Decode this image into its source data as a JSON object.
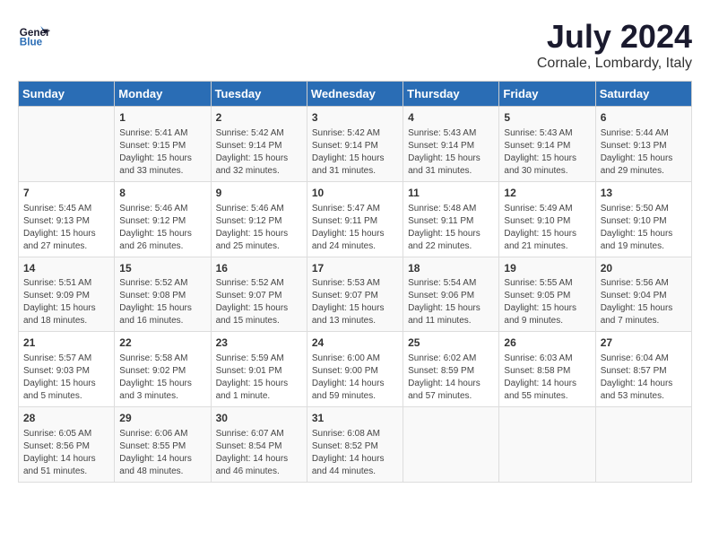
{
  "header": {
    "logo_general": "General",
    "logo_blue": "Blue",
    "month": "July 2024",
    "location": "Cornale, Lombardy, Italy"
  },
  "days_of_week": [
    "Sunday",
    "Monday",
    "Tuesday",
    "Wednesday",
    "Thursday",
    "Friday",
    "Saturday"
  ],
  "weeks": [
    [
      {
        "day": "",
        "info": ""
      },
      {
        "day": "1",
        "info": "Sunrise: 5:41 AM\nSunset: 9:15 PM\nDaylight: 15 hours\nand 33 minutes."
      },
      {
        "day": "2",
        "info": "Sunrise: 5:42 AM\nSunset: 9:14 PM\nDaylight: 15 hours\nand 32 minutes."
      },
      {
        "day": "3",
        "info": "Sunrise: 5:42 AM\nSunset: 9:14 PM\nDaylight: 15 hours\nand 31 minutes."
      },
      {
        "day": "4",
        "info": "Sunrise: 5:43 AM\nSunset: 9:14 PM\nDaylight: 15 hours\nand 31 minutes."
      },
      {
        "day": "5",
        "info": "Sunrise: 5:43 AM\nSunset: 9:14 PM\nDaylight: 15 hours\nand 30 minutes."
      },
      {
        "day": "6",
        "info": "Sunrise: 5:44 AM\nSunset: 9:13 PM\nDaylight: 15 hours\nand 29 minutes."
      }
    ],
    [
      {
        "day": "7",
        "info": "Sunrise: 5:45 AM\nSunset: 9:13 PM\nDaylight: 15 hours\nand 27 minutes."
      },
      {
        "day": "8",
        "info": "Sunrise: 5:46 AM\nSunset: 9:12 PM\nDaylight: 15 hours\nand 26 minutes."
      },
      {
        "day": "9",
        "info": "Sunrise: 5:46 AM\nSunset: 9:12 PM\nDaylight: 15 hours\nand 25 minutes."
      },
      {
        "day": "10",
        "info": "Sunrise: 5:47 AM\nSunset: 9:11 PM\nDaylight: 15 hours\nand 24 minutes."
      },
      {
        "day": "11",
        "info": "Sunrise: 5:48 AM\nSunset: 9:11 PM\nDaylight: 15 hours\nand 22 minutes."
      },
      {
        "day": "12",
        "info": "Sunrise: 5:49 AM\nSunset: 9:10 PM\nDaylight: 15 hours\nand 21 minutes."
      },
      {
        "day": "13",
        "info": "Sunrise: 5:50 AM\nSunset: 9:10 PM\nDaylight: 15 hours\nand 19 minutes."
      }
    ],
    [
      {
        "day": "14",
        "info": "Sunrise: 5:51 AM\nSunset: 9:09 PM\nDaylight: 15 hours\nand 18 minutes."
      },
      {
        "day": "15",
        "info": "Sunrise: 5:52 AM\nSunset: 9:08 PM\nDaylight: 15 hours\nand 16 minutes."
      },
      {
        "day": "16",
        "info": "Sunrise: 5:52 AM\nSunset: 9:07 PM\nDaylight: 15 hours\nand 15 minutes."
      },
      {
        "day": "17",
        "info": "Sunrise: 5:53 AM\nSunset: 9:07 PM\nDaylight: 15 hours\nand 13 minutes."
      },
      {
        "day": "18",
        "info": "Sunrise: 5:54 AM\nSunset: 9:06 PM\nDaylight: 15 hours\nand 11 minutes."
      },
      {
        "day": "19",
        "info": "Sunrise: 5:55 AM\nSunset: 9:05 PM\nDaylight: 15 hours\nand 9 minutes."
      },
      {
        "day": "20",
        "info": "Sunrise: 5:56 AM\nSunset: 9:04 PM\nDaylight: 15 hours\nand 7 minutes."
      }
    ],
    [
      {
        "day": "21",
        "info": "Sunrise: 5:57 AM\nSunset: 9:03 PM\nDaylight: 15 hours\nand 5 minutes."
      },
      {
        "day": "22",
        "info": "Sunrise: 5:58 AM\nSunset: 9:02 PM\nDaylight: 15 hours\nand 3 minutes."
      },
      {
        "day": "23",
        "info": "Sunrise: 5:59 AM\nSunset: 9:01 PM\nDaylight: 15 hours\nand 1 minute."
      },
      {
        "day": "24",
        "info": "Sunrise: 6:00 AM\nSunset: 9:00 PM\nDaylight: 14 hours\nand 59 minutes."
      },
      {
        "day": "25",
        "info": "Sunrise: 6:02 AM\nSunset: 8:59 PM\nDaylight: 14 hours\nand 57 minutes."
      },
      {
        "day": "26",
        "info": "Sunrise: 6:03 AM\nSunset: 8:58 PM\nDaylight: 14 hours\nand 55 minutes."
      },
      {
        "day": "27",
        "info": "Sunrise: 6:04 AM\nSunset: 8:57 PM\nDaylight: 14 hours\nand 53 minutes."
      }
    ],
    [
      {
        "day": "28",
        "info": "Sunrise: 6:05 AM\nSunset: 8:56 PM\nDaylight: 14 hours\nand 51 minutes."
      },
      {
        "day": "29",
        "info": "Sunrise: 6:06 AM\nSunset: 8:55 PM\nDaylight: 14 hours\nand 48 minutes."
      },
      {
        "day": "30",
        "info": "Sunrise: 6:07 AM\nSunset: 8:54 PM\nDaylight: 14 hours\nand 46 minutes."
      },
      {
        "day": "31",
        "info": "Sunrise: 6:08 AM\nSunset: 8:52 PM\nDaylight: 14 hours\nand 44 minutes."
      },
      {
        "day": "",
        "info": ""
      },
      {
        "day": "",
        "info": ""
      },
      {
        "day": "",
        "info": ""
      }
    ]
  ]
}
